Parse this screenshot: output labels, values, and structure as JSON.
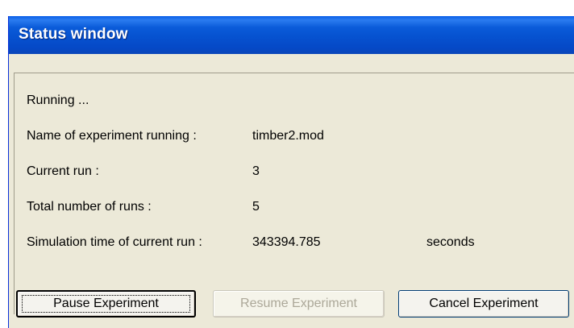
{
  "window": {
    "title": "Status window"
  },
  "status": {
    "state_text": "Running ...",
    "rows": [
      {
        "label": "Name of experiment running :",
        "value": "timber2.mod"
      },
      {
        "label": "Current run :",
        "value": "3"
      },
      {
        "label": "Total number of runs :",
        "value": "5"
      },
      {
        "label": "Simulation time of current run :",
        "value": "343394.785",
        "unit": "seconds"
      }
    ]
  },
  "buttons": {
    "pause": "Pause Experiment",
    "resume": "Resume Experiment",
    "cancel": "Cancel Experiment"
  },
  "colors": {
    "titlebar": "#0a5bd9",
    "dialog_background": "#ece9d8",
    "disabled_text": "#aca899"
  }
}
